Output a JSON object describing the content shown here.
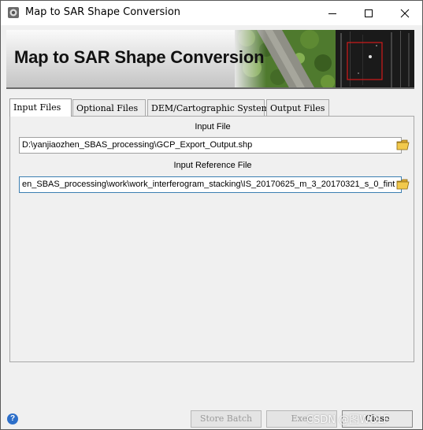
{
  "window": {
    "title": "Map to SAR Shape Conversion"
  },
  "banner": {
    "title": "Map to SAR Shape Conversion"
  },
  "tabs": [
    {
      "label": "Input Files",
      "active": true
    },
    {
      "label": "Optional Files",
      "active": false
    },
    {
      "label": "DEM/Cartographic System",
      "active": false
    },
    {
      "label": "Output Files",
      "active": false
    }
  ],
  "input_files": {
    "input_file_label": "Input File",
    "input_file_value": "D:\\yanjiaozhen_SBAS_processing\\GCP_Export_Output.shp",
    "reference_file_label": "Input Reference File",
    "reference_file_value": "en_SBAS_processing\\work\\work_interferogram_stacking\\IS_20170625_m_3_20170321_s_0_fint"
  },
  "footer": {
    "help_icon_text": "?",
    "store_batch_label": "Store Batch",
    "exec_label": "Exec",
    "close_label": "Close",
    "watermark": "CSDN @图WOLF"
  },
  "icons": {
    "app": "app-icon",
    "minimize": "minimize-icon",
    "maximize": "maximize-icon",
    "close": "close-icon",
    "folder": "folder-icon",
    "help": "help-icon"
  },
  "colors": {
    "accent_focus": "#3c7fb1",
    "help_blue": "#2d6fc9",
    "banner_frame_red": "#d11a1a"
  }
}
